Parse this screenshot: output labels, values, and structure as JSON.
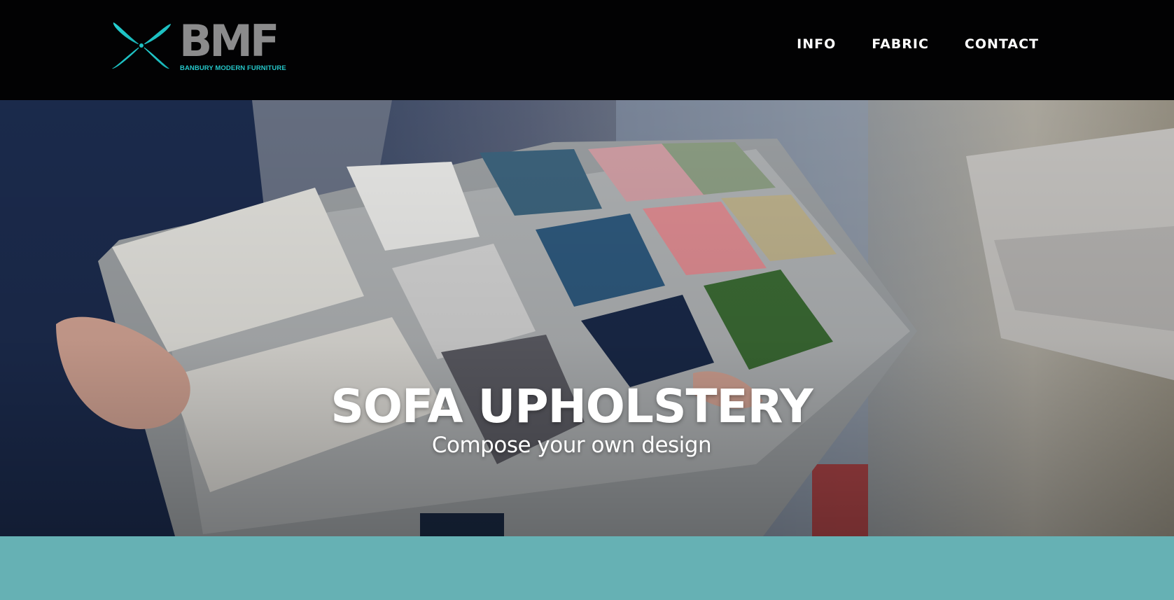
{
  "brand": {
    "name": "BMF",
    "tagline": "BANBURY MODERN FURNITURE",
    "logo_icon": "propeller-x-icon",
    "accent_color": "#25c7c9",
    "wordmark_color": "#8b8b8c"
  },
  "nav": {
    "items": [
      {
        "label": "INFO"
      },
      {
        "label": "FABRIC"
      },
      {
        "label": "CONTACT"
      }
    ]
  },
  "hero": {
    "title": "SOFA UPHOLSTERY",
    "subtitle": "Compose your own design",
    "image": "fabric-swatch-book-photo"
  },
  "band": {
    "color": "#66b1b4"
  }
}
